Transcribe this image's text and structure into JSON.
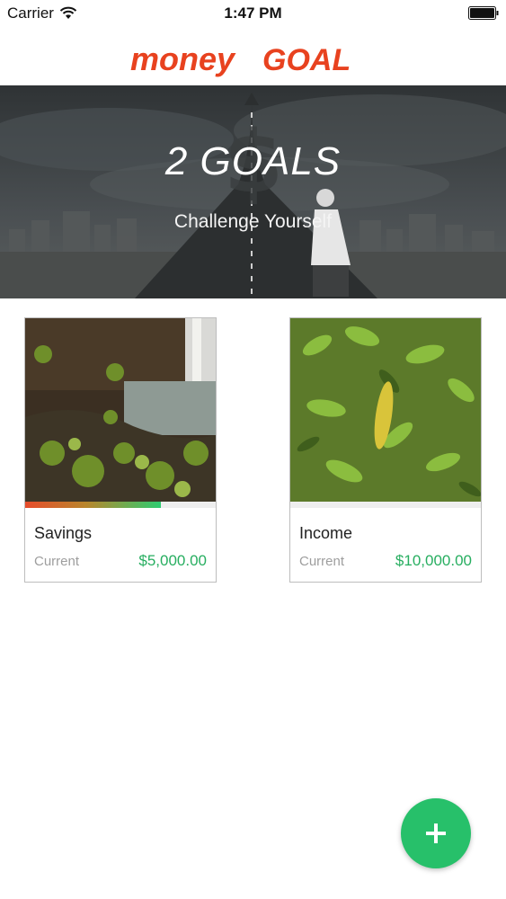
{
  "status_bar": {
    "carrier": "Carrier",
    "time": "1:47 PM",
    "icons": [
      "wifi-icon",
      "battery-icon"
    ]
  },
  "logo": {
    "text_part1": "money",
    "text_part2": "GOAL",
    "color": "#e8421f"
  },
  "hero": {
    "title": "2 GOALS",
    "subtitle": "Challenge Yourself"
  },
  "goals": [
    {
      "title": "Savings",
      "label": "Current",
      "value": "$5,000.00",
      "progress": 0.71,
      "image": "waterfall-plants"
    },
    {
      "title": "Income",
      "label": "Current",
      "value": "$10,000.00",
      "progress": 0,
      "image": "green-leaves"
    }
  ],
  "fab": {
    "icon": "plus-icon",
    "color": "#27c06a"
  },
  "colors": {
    "value_green": "#27ae60",
    "progress_start": "#e74c2b",
    "progress_end": "#2ecc71"
  }
}
